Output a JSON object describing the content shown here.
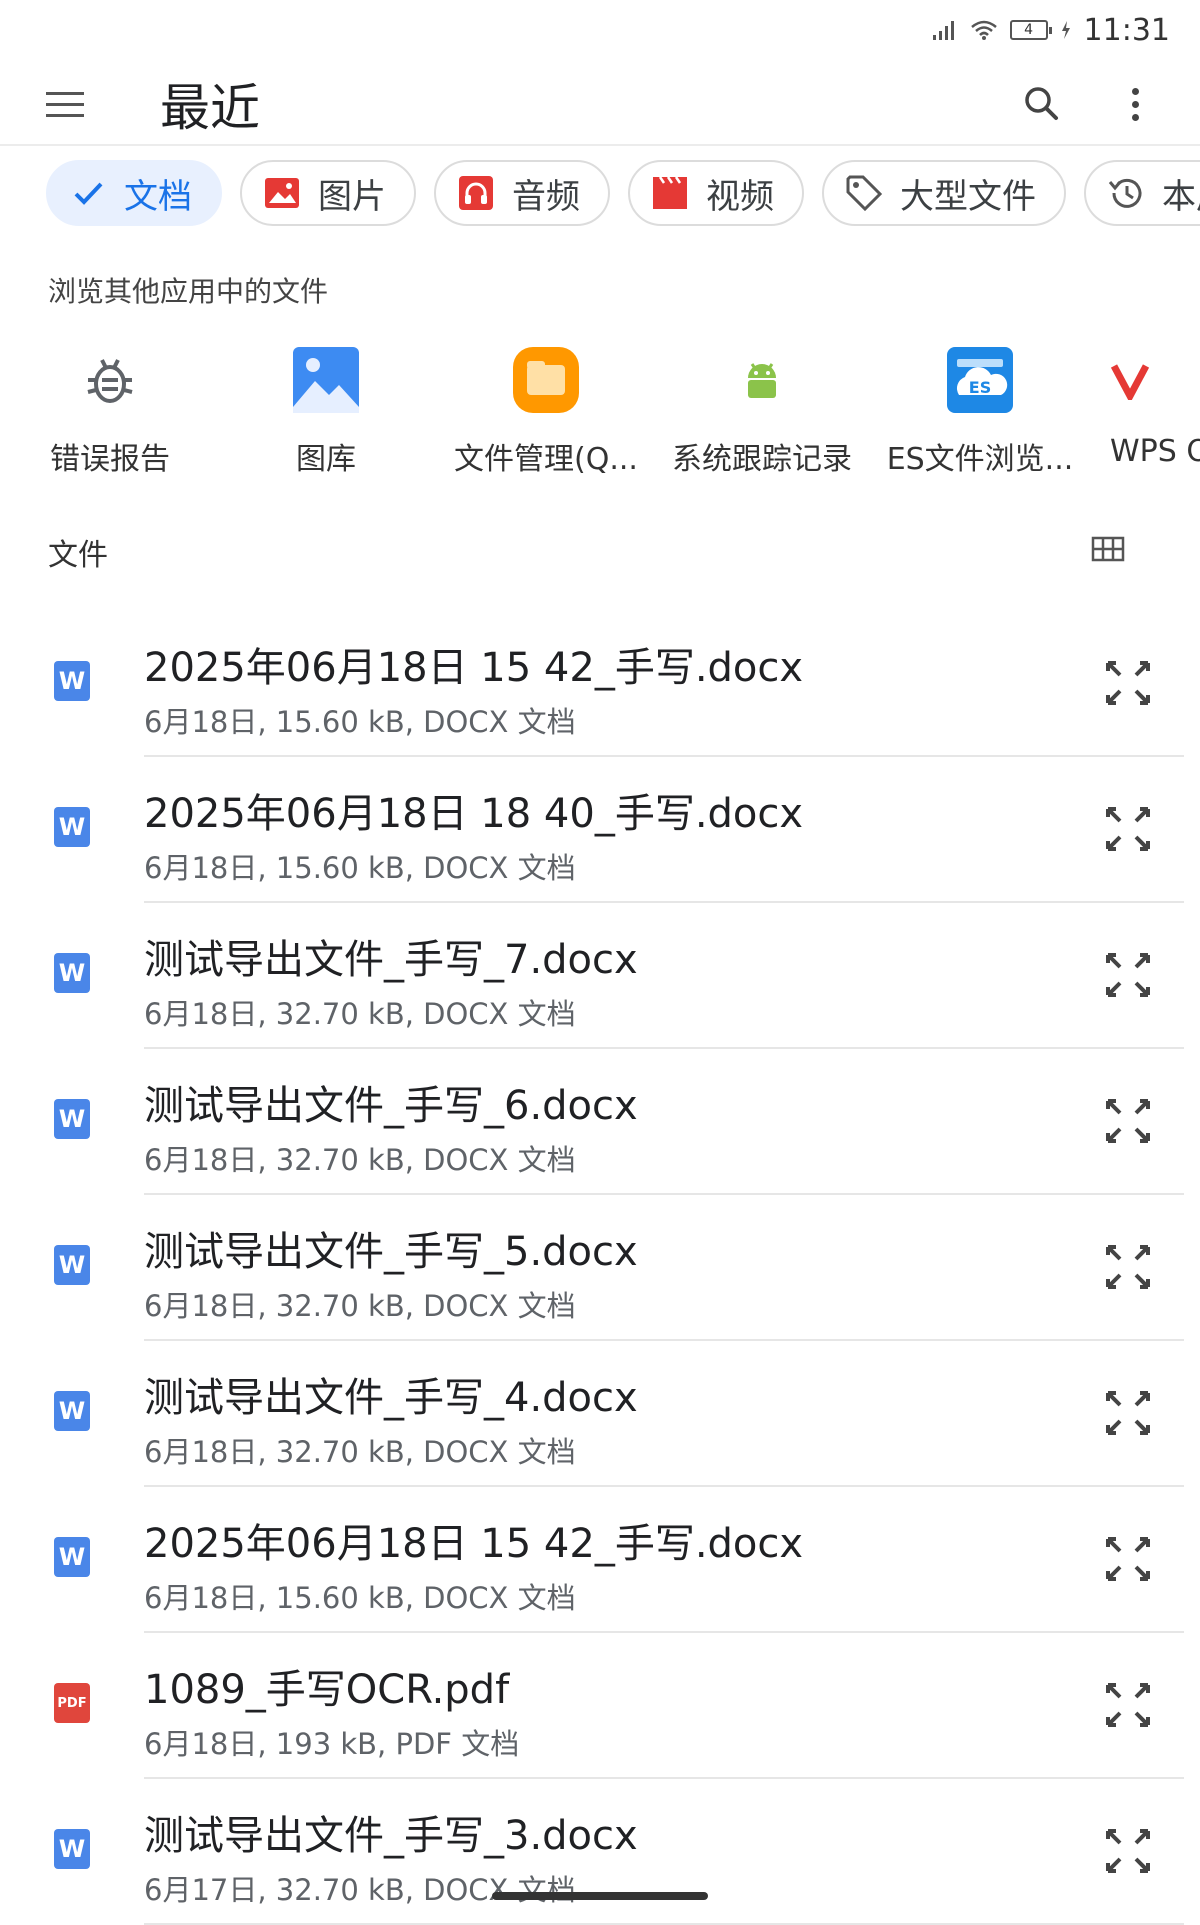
{
  "status_bar": {
    "time": "11:31",
    "battery": "4"
  },
  "app_bar": {
    "title": "最近"
  },
  "chips": [
    {
      "label": "文档",
      "icon": "check-icon",
      "selected": true
    },
    {
      "label": "图片",
      "icon": "image-icon",
      "selected": false
    },
    {
      "label": "音频",
      "icon": "headphones-icon",
      "selected": false
    },
    {
      "label": "视频",
      "icon": "clapperboard-icon",
      "selected": false
    },
    {
      "label": "大型文件",
      "icon": "tag-icon",
      "selected": false
    },
    {
      "label": "本周",
      "icon": "history-icon",
      "selected": false
    }
  ],
  "browse_section": {
    "caption": "浏览其他应用中的文件"
  },
  "apps": [
    {
      "label": "错误报告",
      "icon": "bug-icon"
    },
    {
      "label": "图库",
      "icon": "gallery-icon"
    },
    {
      "label": "文件管理(Q...",
      "icon": "file-manager-icon"
    },
    {
      "label": "系统跟踪记录",
      "icon": "android-icon"
    },
    {
      "label": "ES文件浏览...",
      "icon": "es-explorer-icon"
    },
    {
      "label": "WPS Office",
      "icon": "wps-icon"
    }
  ],
  "files_section": {
    "title": "文件"
  },
  "files": [
    {
      "name": "2025年06月18日 15 42_手写.docx",
      "meta": "6月18日, 15.60 kB, DOCX 文档",
      "type": "word"
    },
    {
      "name": "2025年06月18日 18 40_手写.docx",
      "meta": "6月18日, 15.60 kB, DOCX 文档",
      "type": "word"
    },
    {
      "name": "测试导出文件_手写_7.docx",
      "meta": "6月18日, 32.70 kB, DOCX 文档",
      "type": "word"
    },
    {
      "name": "测试导出文件_手写_6.docx",
      "meta": "6月18日, 32.70 kB, DOCX 文档",
      "type": "word"
    },
    {
      "name": "测试导出文件_手写_5.docx",
      "meta": "6月18日, 32.70 kB, DOCX 文档",
      "type": "word"
    },
    {
      "name": "测试导出文件_手写_4.docx",
      "meta": "6月18日, 32.70 kB, DOCX 文档",
      "type": "word"
    },
    {
      "name": "2025年06月18日 15 42_手写.docx",
      "meta": "6月18日, 15.60 kB, DOCX 文档",
      "type": "word"
    },
    {
      "name": "1089_手写OCR.pdf",
      "meta": "6月18日, 193 kB, PDF 文档",
      "type": "pdf"
    },
    {
      "name": "测试导出文件_手写_3.docx",
      "meta": "6月17日, 32.70 kB, DOCX 文档",
      "type": "word"
    }
  ],
  "file_type_labels": {
    "word": "W",
    "pdf": "PDF"
  },
  "colors": {
    "accent": "#1a73e8",
    "chip_selected_bg": "#e8f0fe",
    "word_icon": "#4a86e8",
    "pdf_icon": "#e0463c"
  }
}
